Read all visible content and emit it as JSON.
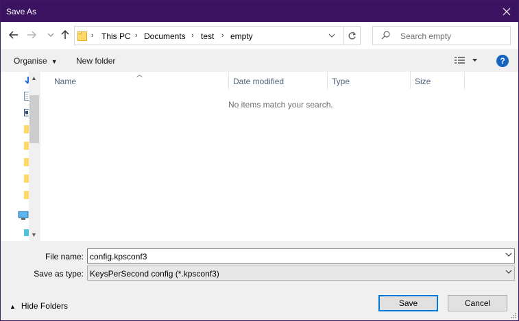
{
  "window": {
    "title": "Save As"
  },
  "address": {
    "crumbs": [
      "This PC",
      "Documents",
      "test",
      "empty"
    ]
  },
  "search": {
    "placeholder": "Search empty"
  },
  "toolbar": {
    "organise": "Organise",
    "new_folder": "New folder",
    "help": "?"
  },
  "columns": [
    "Name",
    "Date modified",
    "Type",
    "Size"
  ],
  "list": {
    "empty_message": "No items match your search."
  },
  "form": {
    "file_name_label": "File name:",
    "file_name_value": "config.kpsconf3",
    "type_label": "Save as type:",
    "type_value": "KeysPerSecond config (*.kpsconf3)"
  },
  "buttons": {
    "save": "Save",
    "cancel": "Cancel",
    "hide_folders": "Hide Folders"
  },
  "colors": {
    "titlebar": "#3b1361",
    "accent": "#0078d7",
    "help": "#1565c0"
  }
}
